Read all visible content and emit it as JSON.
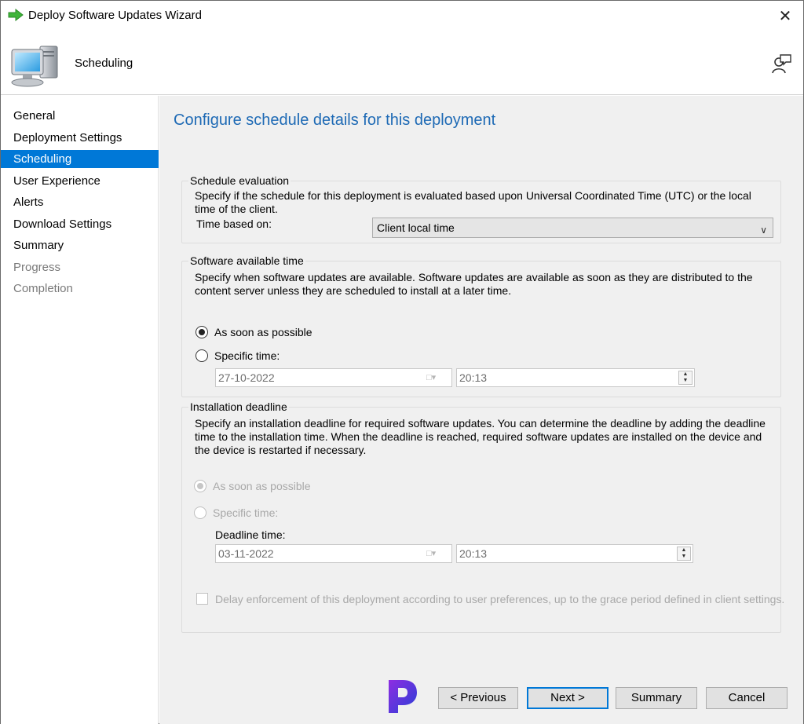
{
  "window": {
    "title": "Deploy Software Updates Wizard",
    "close_glyph": "✕"
  },
  "header": {
    "title": "Scheduling",
    "icon": "computer-icon",
    "help_icon": "help-person-icon"
  },
  "nav": {
    "items": [
      {
        "label": "General",
        "state": "normal"
      },
      {
        "label": "Deployment Settings",
        "state": "normal"
      },
      {
        "label": "Scheduling",
        "state": "active"
      },
      {
        "label": "User Experience",
        "state": "normal"
      },
      {
        "label": "Alerts",
        "state": "normal"
      },
      {
        "label": "Download Settings",
        "state": "normal"
      },
      {
        "label": "Summary",
        "state": "normal"
      },
      {
        "label": "Progress",
        "state": "disabled"
      },
      {
        "label": "Completion",
        "state": "disabled"
      }
    ]
  },
  "main": {
    "heading": "Configure schedule details for this deployment",
    "schedule_evaluation": {
      "title": "Schedule evaluation",
      "description": "Specify if the schedule for this deployment is evaluated based upon Universal Coordinated Time (UTC) or the local time of the client.",
      "time_based_on_label": "Time based on:",
      "time_based_on_value": "Client local time"
    },
    "software_available": {
      "title": "Software available time",
      "description": "Specify when software updates are available. Software updates are available as soon as they are distributed to the content server unless they are scheduled to install at a later time.",
      "asap_label": "As soon as possible",
      "asap_checked": true,
      "specific_label": "Specific time:",
      "specific_checked": false,
      "date": "27-10-2022",
      "time": "20:13"
    },
    "installation_deadline": {
      "title": "Installation deadline",
      "description": "Specify an installation deadline for required software updates. You can determine the deadline by adding the deadline time to the installation time. When the deadline is reached, required software updates are installed on the device and the device is restarted if necessary.",
      "asap_label": "As soon as possible",
      "asap_checked": true,
      "specific_label": "Specific time:",
      "deadline_label": "Deadline time:",
      "date": "03-11-2022",
      "time": "20:13",
      "delay_label": "Delay enforcement of this deployment according to user preferences, up to the grace period defined in client settings.",
      "delay_checked": false
    }
  },
  "footer": {
    "previous": "< Previous",
    "next": "Next >",
    "summary": "Summary",
    "cancel": "Cancel"
  },
  "colors": {
    "accent": "#0078d7",
    "heading": "#1e6ab5",
    "panel": "#f0f0f0"
  }
}
